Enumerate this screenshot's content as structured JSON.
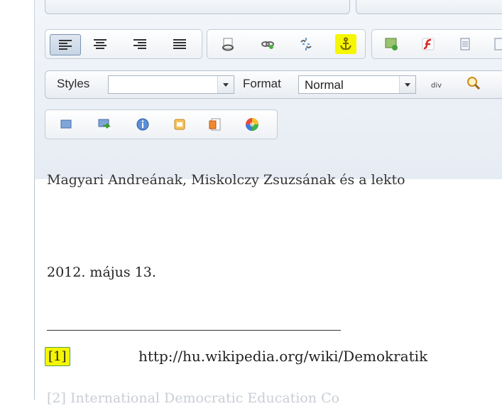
{
  "toolbar": {
    "styles_label": "Styles",
    "styles_value": "",
    "format_label": "Format",
    "format_value": "Normal"
  },
  "document": {
    "cut_top_text": "Magyari Andreának, Miskolczy Zsuzsának és a lekto",
    "date": "2012. május 13.",
    "footnote_marker": "[1]",
    "footnote_url": "http://hu.wikipedia.org/wiki/Demokratik",
    "cut_bottom_text": "[2]          International Democratic Education Co"
  },
  "colors": {
    "highlight": "#f4f500",
    "toolbar_bg": "#eef1f5",
    "active_button": "#c6d4e4"
  },
  "icons": [
    "align-left-icon",
    "align-center-icon",
    "align-right-icon",
    "align-justify-icon",
    "link-icon",
    "link-green-icon",
    "unlink-icon",
    "anchor-icon",
    "image-icon",
    "flash-icon",
    "table-icon",
    "div-icon",
    "find-icon",
    "blue-block-icon",
    "export-icon",
    "info-icon",
    "template-icon",
    "page-icon",
    "color-wheel-icon"
  ]
}
